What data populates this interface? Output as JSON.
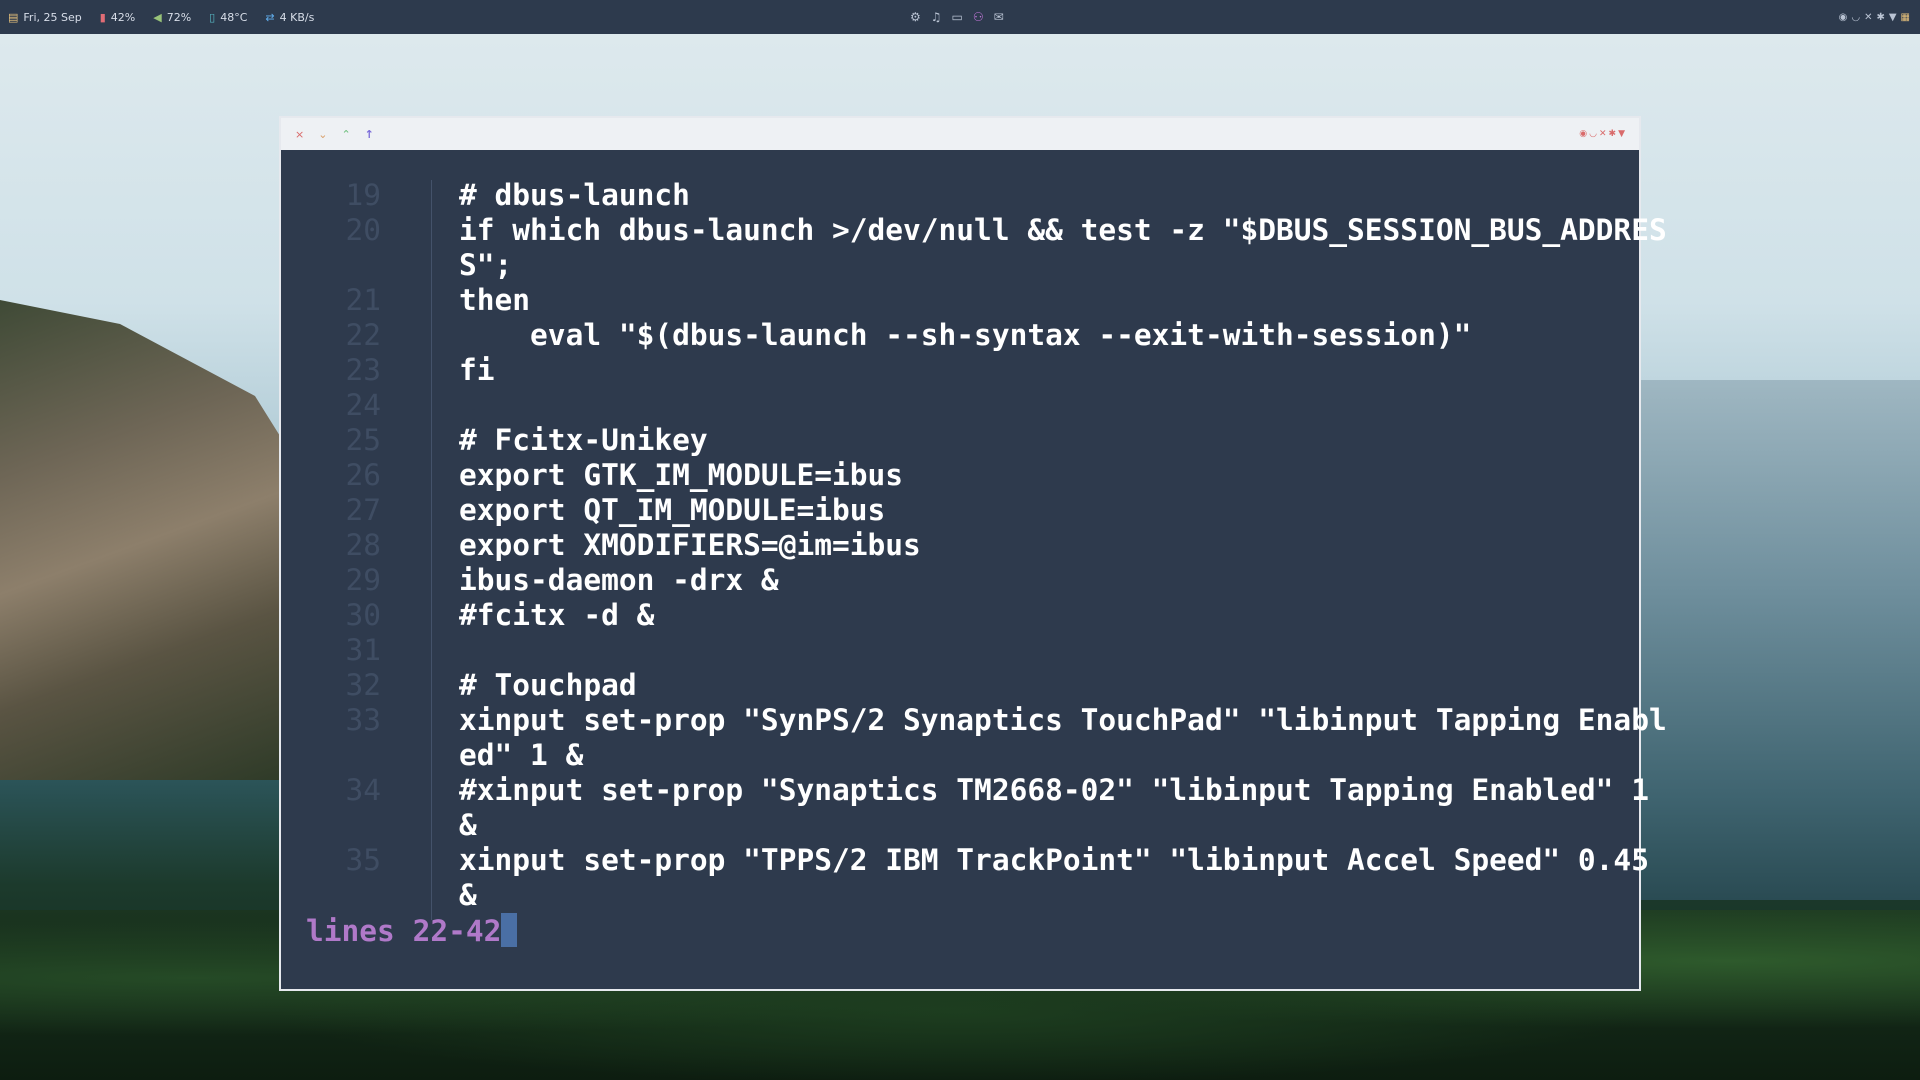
{
  "topbar": {
    "date": "Fri, 25 Sep",
    "battery": "42%",
    "volume": "72%",
    "temperature": "48°C",
    "network": "4 KB/s",
    "center_icons": [
      "gear-icon",
      "music-icon",
      "chat-icon",
      "users-icon",
      "mail-icon"
    ]
  },
  "window": {
    "controls": [
      "×",
      "⌄",
      "⌃",
      "↑"
    ]
  },
  "editor": {
    "lines": [
      {
        "num": "19",
        "text": "# dbus-launch"
      },
      {
        "num": "20",
        "text": "if which dbus-launch >/dev/null && test -z \"$DBUS_SESSION_BUS_ADDRES"
      },
      {
        "num": "",
        "text": "S\";"
      },
      {
        "num": "21",
        "text": "then"
      },
      {
        "num": "22",
        "text": "    eval \"$(dbus-launch --sh-syntax --exit-with-session)\""
      },
      {
        "num": "23",
        "text": "fi"
      },
      {
        "num": "24",
        "text": ""
      },
      {
        "num": "25",
        "text": "# Fcitx-Unikey"
      },
      {
        "num": "26",
        "text": "export GTK_IM_MODULE=ibus"
      },
      {
        "num": "27",
        "text": "export QT_IM_MODULE=ibus"
      },
      {
        "num": "28",
        "text": "export XMODIFIERS=@im=ibus"
      },
      {
        "num": "29",
        "text": "ibus-daemon -drx &"
      },
      {
        "num": "30",
        "text": "#fcitx -d &"
      },
      {
        "num": "31",
        "text": ""
      },
      {
        "num": "32",
        "text": "# Touchpad"
      },
      {
        "num": "33",
        "text": "xinput set-prop \"SynPS/2 Synaptics TouchPad\" \"libinput Tapping Enabl"
      },
      {
        "num": "",
        "text": "ed\" 1 &"
      },
      {
        "num": "34",
        "text": "#xinput set-prop \"Synaptics TM2668-02\" \"libinput Tapping Enabled\" 1"
      },
      {
        "num": "",
        "text": "&"
      },
      {
        "num": "35",
        "text": "xinput set-prop \"TPPS/2 IBM TrackPoint\" \"libinput Accel Speed\" 0.45"
      },
      {
        "num": "",
        "text": "&"
      }
    ],
    "status": "lines 22-42"
  }
}
